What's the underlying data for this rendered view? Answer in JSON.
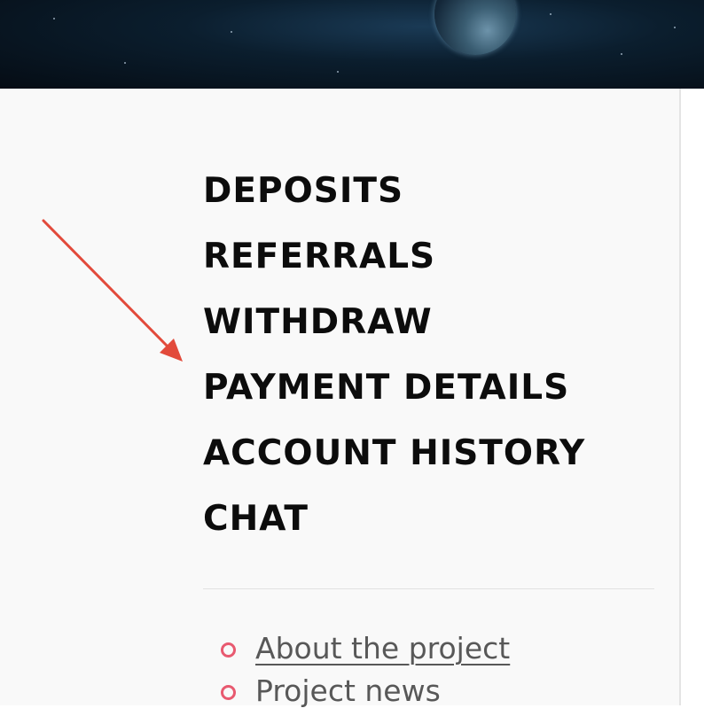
{
  "nav": {
    "items": [
      {
        "label": "DEPOSITS",
        "name": "nav-item-deposits"
      },
      {
        "label": "REFERRALS",
        "name": "nav-item-referrals"
      },
      {
        "label": "WITHDRAW",
        "name": "nav-item-withdraw"
      },
      {
        "label": "PAYMENT DETAILS",
        "name": "nav-item-payment-details"
      },
      {
        "label": "ACCOUNT HISTORY",
        "name": "nav-item-account-history"
      },
      {
        "label": "CHAT",
        "name": "nav-item-chat"
      }
    ]
  },
  "footer_links": {
    "items": [
      {
        "label": "About the project",
        "name": "link-about-the-project"
      },
      {
        "label": "Project news",
        "name": "link-project-news"
      }
    ]
  },
  "annotation": {
    "icon": "arrow-icon",
    "color": "#e24a3b"
  },
  "colors": {
    "panel_background": "#f9f9f9",
    "menu_text": "#0c0c0c",
    "link_text": "#585858",
    "bullet": "#e85a70"
  }
}
